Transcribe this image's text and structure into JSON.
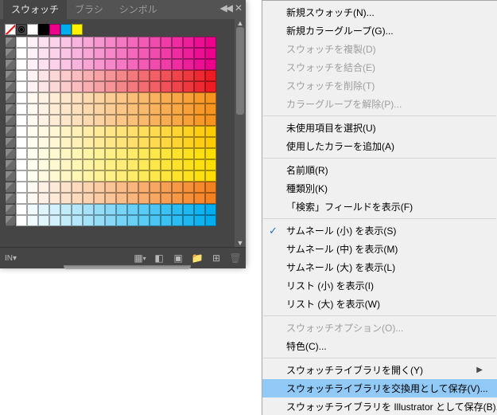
{
  "panel": {
    "tabs": [
      "スウォッチ",
      "ブラシ",
      "シンボル"
    ],
    "activeTab": 0,
    "preset_colors": [
      "#ffffff",
      "#000000",
      "#ec008c",
      "#00aeef",
      "#fff200"
    ],
    "grid_base": [
      "#ec008c",
      "#ed1c24",
      "#f7941d",
      "#ffcb05",
      "#fedd00",
      "#f58220",
      "#00aeef"
    ],
    "grid_rows": 17,
    "footer_icons": [
      "library",
      "pin",
      "color-group",
      "new-swatch",
      "new-folder",
      "delete"
    ]
  },
  "menu": {
    "groups": [
      [
        {
          "label": "新規スウォッチ(N)...",
          "enabled": true
        },
        {
          "label": "新規カラーグループ(G)...",
          "enabled": true
        },
        {
          "label": "スウォッチを複製(D)",
          "enabled": false
        },
        {
          "label": "スウォッチを結合(E)",
          "enabled": false
        },
        {
          "label": "スウォッチを削除(T)",
          "enabled": false
        },
        {
          "label": "カラーグループを解除(P)...",
          "enabled": false
        }
      ],
      [
        {
          "label": "未使用項目を選択(U)",
          "enabled": true
        },
        {
          "label": "使用したカラーを追加(A)",
          "enabled": true
        }
      ],
      [
        {
          "label": "名前順(R)",
          "enabled": true
        },
        {
          "label": "種類別(K)",
          "enabled": true
        },
        {
          "label": "「検索」フィールドを表示(F)",
          "enabled": true
        }
      ],
      [
        {
          "label": "サムネール (小) を表示(S)",
          "enabled": true,
          "checked": true
        },
        {
          "label": "サムネール (中) を表示(M)",
          "enabled": true
        },
        {
          "label": "サムネール (大) を表示(L)",
          "enabled": true
        },
        {
          "label": "リスト (小) を表示(I)",
          "enabled": true
        },
        {
          "label": "リスト (大) を表示(W)",
          "enabled": true
        }
      ],
      [
        {
          "label": "スウォッチオプション(O)...",
          "enabled": false
        },
        {
          "label": "特色(C)...",
          "enabled": true
        }
      ],
      [
        {
          "label": "スウォッチライブラリを開く(Y)",
          "enabled": true,
          "submenu": true
        },
        {
          "label": "スウォッチライブラリを交換用として保存(V)...",
          "enabled": true,
          "highlight": true
        },
        {
          "label": "スウォッチライブラリを Illustrator として保存(B)...",
          "enabled": true
        }
      ]
    ]
  }
}
